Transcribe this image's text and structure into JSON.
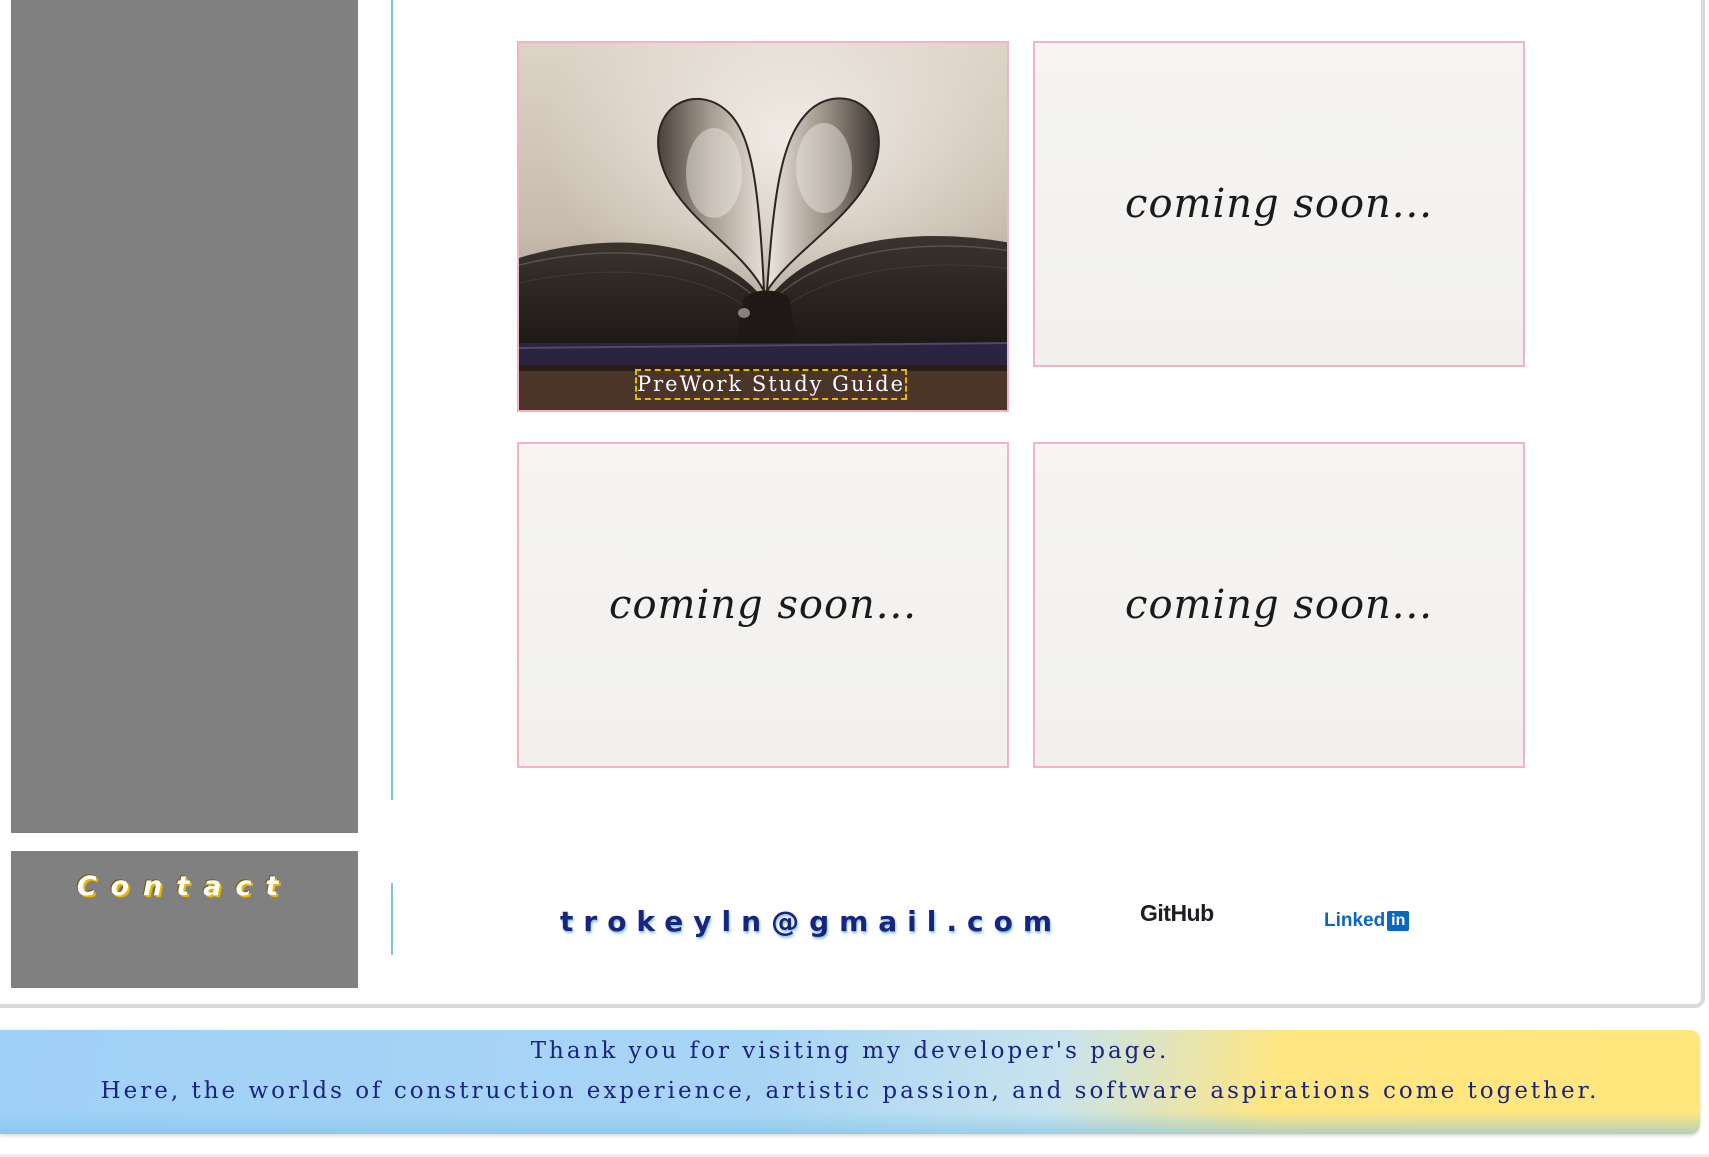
{
  "sidebar": {
    "contact_heading": "Contact"
  },
  "portfolio": {
    "cards": [
      {
        "caption": "PreWork Study Guide",
        "image": "heart-book-photo"
      },
      {
        "text": "coming soon..."
      },
      {
        "text": "coming soon..."
      },
      {
        "text": "coming soon..."
      }
    ]
  },
  "contact": {
    "email": "trokeyln@gmail.com",
    "github_label": "GitHub",
    "linkedin_label": "Linked",
    "linkedin_in": "in"
  },
  "footer": {
    "line1": "Thank you for visiting my developer's page.",
    "line2": "Here, the worlds of construction experience, artistic passion, and software aspirations come together."
  },
  "colors": {
    "sidebar": "#808080",
    "divider": "#7ec3e4",
    "card_border": "#f5b2c0",
    "caption_border": "#e6b800",
    "email_text": "#1a237e",
    "footer_blue": "#9fd0f7",
    "footer_yellow": "#ffe77e"
  }
}
